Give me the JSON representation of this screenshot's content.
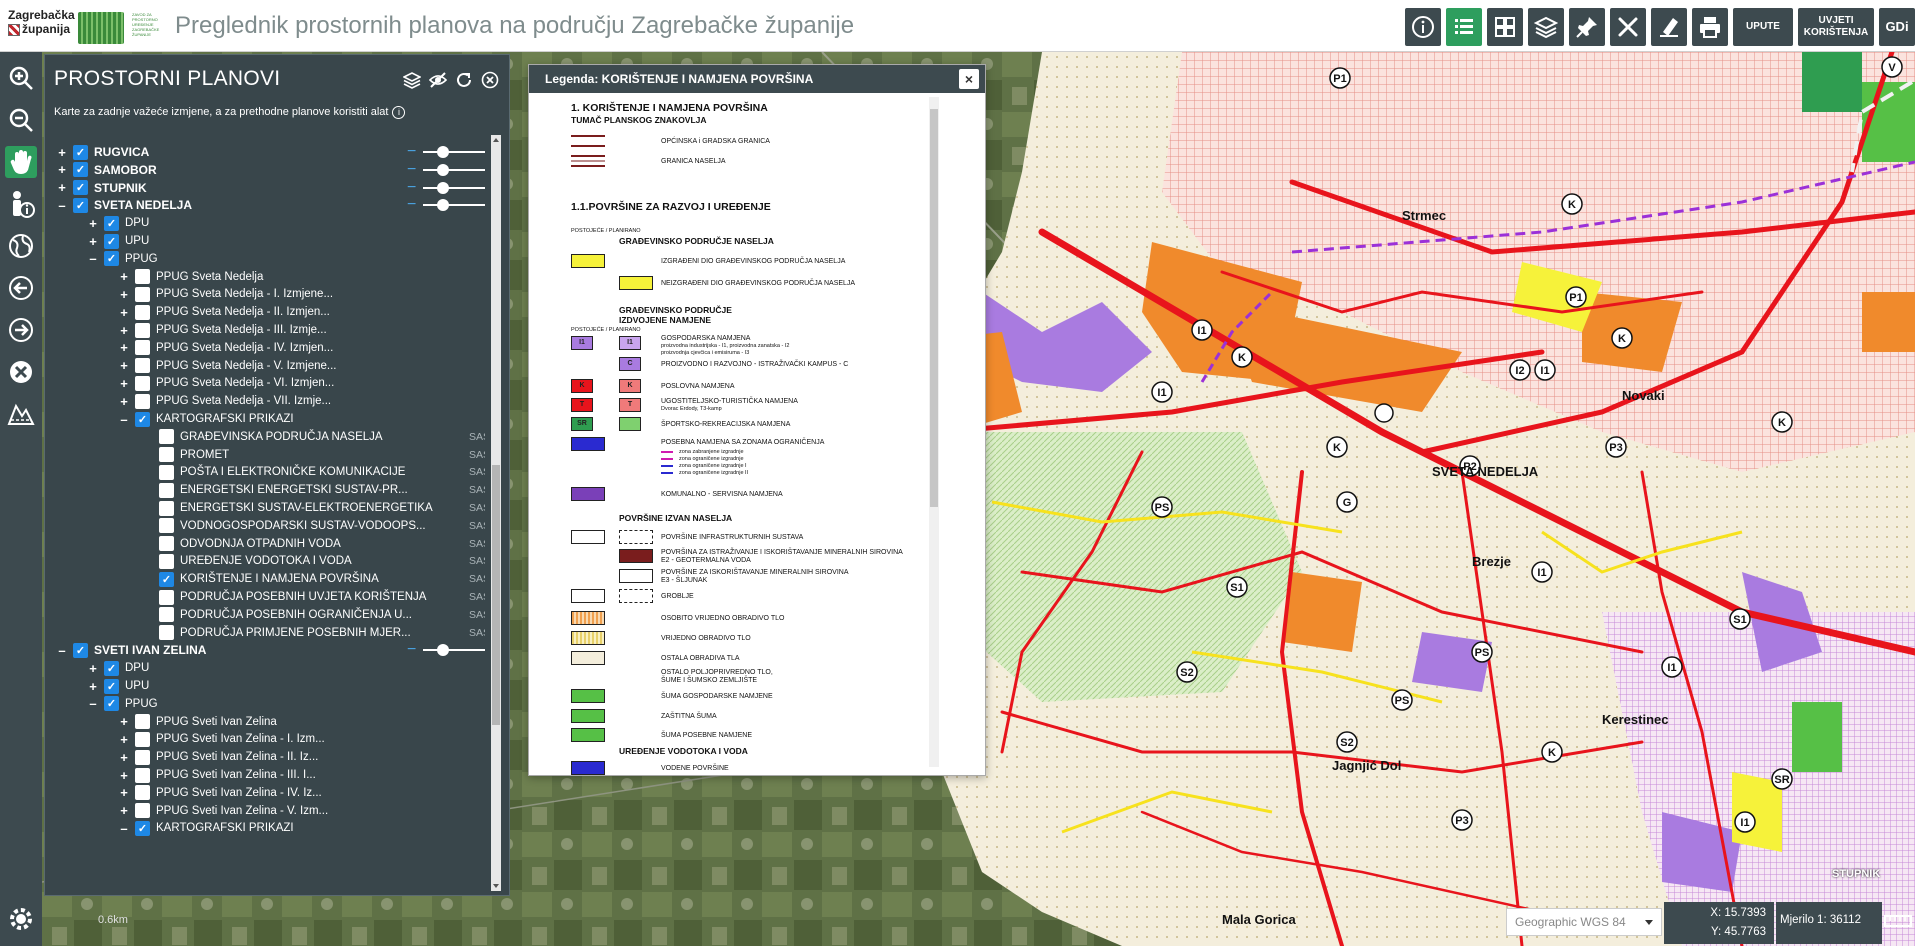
{
  "header": {
    "logo_line1": "Zagrebačka",
    "logo_line2": "županija",
    "logo2_text": "ZAVOD ZA PROSTORNO UREĐENJE ZAGREBAČKE ŽUPANIJE",
    "title": "Preglednik prostornih planova na području Zagrebačke županije",
    "buttons": [
      {
        "name": "info-icon"
      },
      {
        "name": "list-icon",
        "active": true
      },
      {
        "name": "layout-icon"
      },
      {
        "name": "layers-icon"
      },
      {
        "name": "pin-icon"
      },
      {
        "name": "tools-icon"
      },
      {
        "name": "eraser-icon"
      },
      {
        "name": "print-icon"
      }
    ],
    "upute": "UPUTE",
    "uvjeti_1": "UVJETI",
    "uvjeti_2": "KORIŠTENJA",
    "gdi": "GDi"
  },
  "left_tools": [
    "zoom-in-icon",
    "zoom-out-icon",
    "hand-icon",
    "info-person-icon",
    "globe-icon",
    "back-icon",
    "forward-icon",
    "clear-icon",
    "measure-icon"
  ],
  "panel": {
    "title": "PROSTORNI PLANOVI",
    "subtitle": "Karte za zadnje važeće izmjene, a za prethodne planove koristiti alat",
    "items": [
      {
        "exp": "+",
        "checked": true,
        "label": "RUGVICA",
        "level": 0,
        "bold": true,
        "slider": true
      },
      {
        "exp": "+",
        "checked": true,
        "label": "SAMOBOR",
        "level": 0,
        "bold": true,
        "slider": true
      },
      {
        "exp": "+",
        "checked": true,
        "label": "STUPNIK",
        "level": 0,
        "bold": true,
        "slider": true
      },
      {
        "exp": "–",
        "checked": true,
        "label": "SVETA NEDELJA",
        "level": 0,
        "bold": true,
        "slider": true
      },
      {
        "exp": "+",
        "checked": true,
        "label": "DPU",
        "level": 1
      },
      {
        "exp": "+",
        "checked": true,
        "label": "UPU",
        "level": 1
      },
      {
        "exp": "–",
        "checked": true,
        "label": "PPUG",
        "level": 1
      },
      {
        "exp": "+",
        "checked": false,
        "label": "PPUG Sveta Nedelja",
        "level": 2
      },
      {
        "exp": "+",
        "checked": false,
        "label": "PPUG Sveta Nedelja - I. Izmjene...",
        "level": 2
      },
      {
        "exp": "+",
        "checked": false,
        "label": "PPUG Sveta Nedelja - II. Izmjen...",
        "level": 2
      },
      {
        "exp": "+",
        "checked": false,
        "label": "PPUG Sveta Nedelja - III. Izmje...",
        "level": 2
      },
      {
        "exp": "+",
        "checked": false,
        "label": "PPUG Sveta Nedelja - IV. Izmjen...",
        "level": 2
      },
      {
        "exp": "+",
        "checked": false,
        "label": "PPUG Sveta Nedelja - V. Izmjene...",
        "level": 2
      },
      {
        "exp": "+",
        "checked": false,
        "label": "PPUG Sveta Nedelja - VI. Izmjen...",
        "level": 2
      },
      {
        "exp": "+",
        "checked": false,
        "label": "PPUG Sveta Nedelja - VII. Izmje...",
        "level": 2
      },
      {
        "exp": "–",
        "checked": true,
        "label": "KARTOGRAFSKI PRIKAZI",
        "level": 2
      },
      {
        "exp": "",
        "checked": false,
        "label": "GRAĐEVINSKA PODRUČJA NASELJA",
        "level": 3,
        "leg": "SAS. LEG."
      },
      {
        "exp": "",
        "checked": false,
        "label": "PROMET",
        "level": 3,
        "leg": "SAS. LEG."
      },
      {
        "exp": "",
        "checked": false,
        "label": "POŠTA I ELEKTRONIČKE KOMUNIKACIJE",
        "level": 3,
        "leg": "SAS. LEG."
      },
      {
        "exp": "",
        "checked": false,
        "label": "ENERGETSKI ENERGETSKI SUSTAV-PR...",
        "level": 3,
        "leg": "SAS. LEG."
      },
      {
        "exp": "",
        "checked": false,
        "label": "ENERGETSKI SUSTAV-ELEKTROENERGETIKA",
        "level": 3,
        "leg": "SAS. LEG."
      },
      {
        "exp": "",
        "checked": false,
        "label": "VODNOGOSPODARSKI SUSTAV-VODOOPS...",
        "level": 3,
        "leg": "SAS. LEG."
      },
      {
        "exp": "",
        "checked": false,
        "label": "ODVODNJA OTPADNIH VODA",
        "level": 3,
        "leg": "SAS. LEG."
      },
      {
        "exp": "",
        "checked": false,
        "label": "UREĐENJE VODOTOKA I VODA",
        "level": 3,
        "leg": "SAS. LEG."
      },
      {
        "exp": "",
        "checked": true,
        "label": "KORIŠTENJE I NAMJENA POVRŠINA",
        "level": 3,
        "leg": "SAS. LEG."
      },
      {
        "exp": "",
        "checked": false,
        "label": "PODRUČJA POSEBNIH UVJETA KORIŠTENJA",
        "level": 3,
        "leg": "SAS. LEG."
      },
      {
        "exp": "",
        "checked": false,
        "label": "PODRUČJA POSEBNIH OGRANIČENJA U...",
        "level": 3,
        "leg": "SAS. LEG."
      },
      {
        "exp": "",
        "checked": false,
        "label": "PODRUČJA PRIMJENE POSEBNIH MJER...",
        "level": 3,
        "leg": "SAS. LEG."
      },
      {
        "exp": "–",
        "checked": true,
        "label": "SVETI IVAN ZELINA",
        "level": 0,
        "bold": true,
        "slider": true
      },
      {
        "exp": "+",
        "checked": true,
        "label": "DPU",
        "level": 1
      },
      {
        "exp": "+",
        "checked": true,
        "label": "UPU",
        "level": 1
      },
      {
        "exp": "–",
        "checked": true,
        "label": "PPUG",
        "level": 1
      },
      {
        "exp": "+",
        "checked": false,
        "label": "PPUG Sveti Ivan Zelina",
        "level": 2
      },
      {
        "exp": "+",
        "checked": false,
        "label": "PPUG Sveti Ivan Zelina - I. Izm...",
        "level": 2
      },
      {
        "exp": "+",
        "checked": false,
        "label": "PPUG Sveti Ivan Zelina - II. Iz...",
        "level": 2
      },
      {
        "exp": "+",
        "checked": false,
        "label": "PPUG Sveti Ivan Zelina - III. I...",
        "level": 2
      },
      {
        "exp": "+",
        "checked": false,
        "label": "PPUG Sveti Ivan Zelina - IV. Iz...",
        "level": 2
      },
      {
        "exp": "+",
        "checked": false,
        "label": "PPUG Sveti Ivan Zelina - V. Izm...",
        "level": 2
      },
      {
        "exp": "–",
        "checked": true,
        "label": "KARTOGRAFSKI PRIKAZI",
        "level": 2
      }
    ]
  },
  "legend": {
    "title": "Legenda: KORIŠTENJE I NAMJENA POVRŠINA",
    "close": "×",
    "h1": "1. KORIŠTENJE I NAMJENA POVRŠINA",
    "tumac": "TUMAČ PLANSKOG ZNAKOVLJA",
    "granica1": "OPĆINSKA i GRADSKA GRANICA",
    "granica2": "GRANICA NASELJA",
    "h11": "1.1.POVRŠINE ZA RAZVOJ I UREĐENJE",
    "postojece": "POSTOJEĆE / PLANIRANO",
    "gpn": "GRAĐEVINSKO PODRUČJE NASELJA",
    "izgradeni": "IZGRAĐENI DIO GRAĐEVINSKOG PODRUČJA NASELJA",
    "neizgradeni": "NEIZGRAĐENI DIO GRAĐEVINSKOG PODRUČJA NASELJA",
    "gpin1": "GRAĐEVINSKO PODRUČJE",
    "gpin2": "IZDVOJENE NAMJENE",
    "postojece2": "POSTOJEĆE / PLANIRANO",
    "gosp1": "GOSPODARSKA NAMJENA",
    "gosp2": "proizvodna industrijska - I1, proizvodna zanatska - I2",
    "gosp3": "proizvodnja cjevčica i emisiruma - I3",
    "proizv": "PROIZVODNO I RAZVOJNO - ISTRAŽIVAČKI KAMPUS - C",
    "poslovna": "POSLOVNA NAMJENA",
    "ugost1": "UGOSTITELJSKO-TURISTIČKA NAMJENA",
    "ugost2": "Dvorac Erdody, T3-kamp",
    "sport": "ŠPORTSKO-REKREACIJSKA NAMJENA",
    "posebna1": "POSEBNA NAMJENA SA ZONAMA OGRANIČENJA",
    "zona1": "zona zabranjene izgradnje",
    "zona2": "zona ograničene izgradnje",
    "zona3": "zona ograničene izgradnje I",
    "zona4": "zona ograničene izgradnje II",
    "komunalno": "KOMUNALNO - SERVISNA NAMJENA",
    "izvan": "POVRŠINE IZVAN NASELJA",
    "infra": "POVRŠINE INFRASTRUKTURNIH SUSTAVA",
    "istr1": "POVRŠINA ZA ISTRAŽIVANJE I ISKORIŠTAVANJE MINERALNIH SIROVINA",
    "istr2": "E2 - GEOTERMALNA VODA",
    "isk1": "POVRŠINE ZA ISKORIŠTAVANJE MINERALNIH SIROVINA",
    "isk2": "E3 - ŠLJUNAK",
    "groblje": "GROBLJE",
    "p1": "OSOBITO VRIJEDNO OBRADIVO TLO",
    "p2": "VRIJEDNO OBRADIVO TLO",
    "p3": "OSTALA OBRADIVA TLA",
    "ps1": "OSTALO POLJOPRIVREDNO TLO,",
    "ps2": "ŠUME I ŠUMSKO ZEMLJIŠTE",
    "s1": "ŠUMA GOSPODARSKE NAMJENE",
    "s2": "ZAŠTITNA ŠUMA",
    "s3": "ŠUMA POSEBNE NAMJENE",
    "uredenje": "UREĐENJE VODOTOKA I VODA",
    "vodene": "VODENE POVRŠINE"
  },
  "map": {
    "labels": [
      "SVETA NEDELJA",
      "Novaki",
      "Brezje",
      "Jagnjić Dol",
      "Kerestinec",
      "Mala Gorica",
      "Strmec"
    ],
    "corner_label": "STUPNIK"
  },
  "footer": {
    "scale_km": "0.6km",
    "crs": "Geographic WGS 84",
    "x": "X: 15.7393",
    "y": "Y: 45.7763",
    "scale": "Mjerilo 1: 36112"
  }
}
